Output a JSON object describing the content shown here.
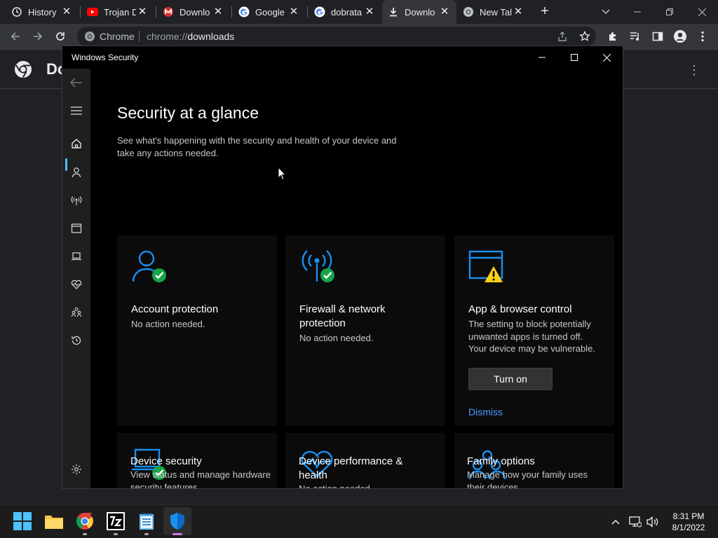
{
  "browser": {
    "tabs": [
      {
        "title": "History",
        "icon": "history-icon"
      },
      {
        "title": "Trojan D",
        "icon": "youtube-icon"
      },
      {
        "title": "Downlo",
        "icon": "malwarebytes-icon"
      },
      {
        "title": "Google",
        "icon": "google-icon"
      },
      {
        "title": "dobrata",
        "icon": "google-icon"
      },
      {
        "title": "Downlo",
        "icon": "download-icon",
        "active": true
      },
      {
        "title": "New Tal",
        "icon": "chrome-icon"
      }
    ],
    "omnibox": {
      "site_label": "Chrome",
      "url_scheme": "chrome://",
      "url_host": "downloads"
    },
    "page_title": "Do"
  },
  "security": {
    "window_title": "Windows Security",
    "heading": "Security at a glance",
    "subheading": "See what's happening with the security and health of your device and take any actions needed.",
    "cards": [
      {
        "title": "Account protection",
        "desc": "No action needed.",
        "icon": "account-check-icon"
      },
      {
        "title": "Firewall & network protection",
        "desc": "No action needed.",
        "icon": "firewall-check-icon"
      },
      {
        "title": "App & browser control",
        "desc": "The setting to block potentially unwanted apps is turned off. Your device may be vulnerable.",
        "icon": "app-warning-icon",
        "button": "Turn on",
        "link": "Dismiss"
      },
      {
        "title": "Device security",
        "desc": "View status and manage hardware security features.",
        "icon": "laptop-check-icon"
      },
      {
        "title": "Device performance & health",
        "desc": "No action needed.",
        "icon": "heart-icon"
      },
      {
        "title": "Family options",
        "desc": "Manage how your family uses their devices.",
        "icon": "family-icon"
      }
    ]
  },
  "taskbar": {
    "time": "8:31 PM",
    "date": "8/1/2022"
  },
  "colors": {
    "accent_blue": "#1a8ff2",
    "ok_green": "#16a34a",
    "warn_yellow": "#fcd116",
    "link_blue": "#4c9bff"
  }
}
